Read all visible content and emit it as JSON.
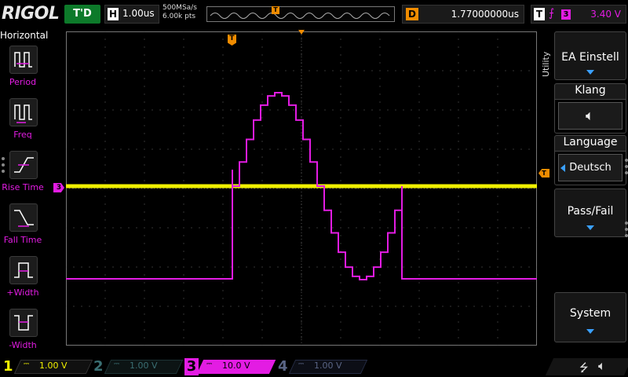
{
  "topbar": {
    "logo": "RIGOL",
    "trigger_status": "T'D",
    "timebase_label": "H",
    "timebase_value": "1.00us",
    "sample_rate": "500MSa/s",
    "memory_points": "6.00k pts",
    "delay_label": "D",
    "delay_value": "1.77000000us",
    "trigger_label": "T",
    "trigger_source": "3",
    "trigger_level": "3.40 V"
  },
  "leftbar": {
    "title": "Horizontal",
    "items": [
      {
        "label": "Period",
        "icon": "period-icon"
      },
      {
        "label": "Freq",
        "icon": "freq-icon"
      },
      {
        "label": "Rise Time",
        "icon": "rise-time-icon"
      },
      {
        "label": "Fall Time",
        "icon": "fall-time-icon"
      },
      {
        "label": "+Width",
        "icon": "positive-width-icon"
      },
      {
        "label": "-Width",
        "icon": "negative-width-icon"
      }
    ]
  },
  "rightbar": {
    "utility_tab": "Utility",
    "buttons": {
      "io_setting": "EA Einstell",
      "sound_title": "Klang",
      "sound_icon": "speaker-icon",
      "language_title": "Language",
      "language_value": "Deutsch",
      "pass_fail": "Pass/Fail",
      "system": "System"
    }
  },
  "bottombar": {
    "channels": [
      {
        "num": "1",
        "value": "1.00 V",
        "color": "#f0f000",
        "active": true
      },
      {
        "num": "2",
        "value": "1.00 V",
        "color": "#3a6f73",
        "active": false
      },
      {
        "num": "3",
        "value": "10.0 V",
        "color": "#e31ce3",
        "active": true
      },
      {
        "num": "4",
        "value": "1.00 V",
        "color": "#3f4a6b",
        "active": false
      }
    ]
  },
  "screen": {
    "channel3_marker": "3",
    "trigger_marker": "T",
    "colors": {
      "ch1": "#f0f000",
      "ch3": "#e31ce3",
      "trigger": "#f08c00",
      "grid": "#555555"
    }
  }
}
